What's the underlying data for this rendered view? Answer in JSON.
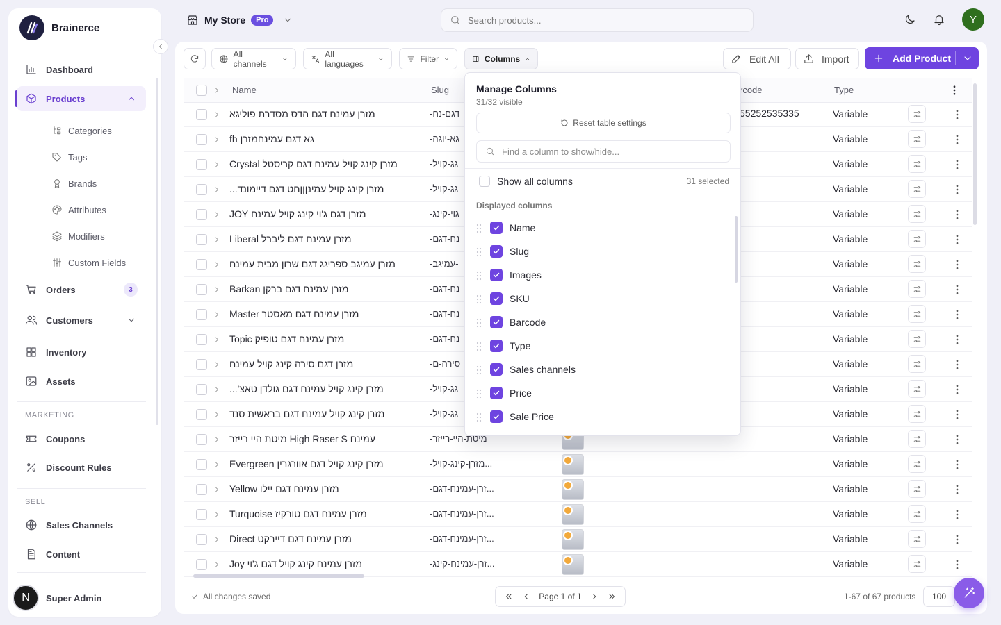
{
  "brand": {
    "name": "Brainerce"
  },
  "sidebar": {
    "items": [
      {
        "label": "Dashboard",
        "icon": "chart-icon"
      },
      {
        "label": "Products",
        "icon": "box-icon"
      },
      {
        "label": "Orders",
        "icon": "cart-icon",
        "badge": "3"
      },
      {
        "label": "Customers",
        "icon": "users-icon"
      },
      {
        "label": "Inventory",
        "icon": "grid-icon"
      },
      {
        "label": "Assets",
        "icon": "image-icon"
      }
    ],
    "sub_items": [
      {
        "label": "Categories"
      },
      {
        "label": "Tags"
      },
      {
        "label": "Brands"
      },
      {
        "label": "Attributes"
      },
      {
        "label": "Modifiers"
      },
      {
        "label": "Custom Fields"
      }
    ],
    "marketing_label": "MARKETING",
    "marketing": [
      {
        "label": "Coupons"
      },
      {
        "label": "Discount Rules"
      }
    ],
    "sell_label": "SELL",
    "sell": [
      {
        "label": "Sales Channels"
      },
      {
        "label": "Content"
      }
    ],
    "user": {
      "initial": "N",
      "name": "Super Admin"
    }
  },
  "topbar": {
    "store_name": "My Store",
    "store_badge": "Pro",
    "search_placeholder": "Search products...",
    "avatar_initial": "Y"
  },
  "toolbar": {
    "channels": "All channels",
    "languages": "All languages",
    "filter": "Filter",
    "columns": "Columns",
    "edit_all": "Edit All",
    "import": "Import",
    "add_product": "Add Product"
  },
  "table": {
    "headers": {
      "name": "Name",
      "slug": "Slug",
      "barcode": "rcode",
      "type": "Type"
    },
    "first_barcode": "55252535335",
    "rows": [
      {
        "name": "מזרן עמינח דגם הדס מסדרת פוליגא",
        "slug": "-דגם-נח",
        "type": "Variable"
      },
      {
        "name": "גא דגם עמינחמזרן fh",
        "slug": "-גא-יוגה",
        "type": "Variable"
      },
      {
        "name": "מזרן קינג קויל עמינח דגם קריסטל Crystal",
        "slug": "-גג-קויל",
        "type": "Variable"
      },
      {
        "name": "מזרן קינג קויל עמינןןןחט דגם דיימונד...",
        "slug": "-גג-קויל",
        "type": "Variable"
      },
      {
        "name": "מזרן דגם ג'וי קינג קויל עמינח JOY",
        "slug": "-גוי-קינג",
        "type": "Variable"
      },
      {
        "name": "מזרן עמינח דגם ליברל Liberal",
        "slug": "-נח-דגם",
        "type": "Variable"
      },
      {
        "name": "מזרן עמיגב ספריגג דגם שרון מבית עמינח",
        "slug": "-עמיגב-",
        "type": "Variable"
      },
      {
        "name": "מזרן עמינח דגם ברקן Barkan",
        "slug": "-נח-דגם",
        "type": "Variable"
      },
      {
        "name": "מזרן עמינח דגם מאסטר Master",
        "slug": "-נח-דגם",
        "type": "Variable"
      },
      {
        "name": "מזרן עמינח דגם טופיק Topic",
        "slug": "-נח-דגם",
        "type": "Variable"
      },
      {
        "name": "מזרן דגם סירה קינג קויל עמינח",
        "slug": "-סירה-ם",
        "type": "Variable"
      },
      {
        "name": "מזרן קינג קויל עמינח דגם גולדן טאצ'...",
        "slug": "-גג-קויל",
        "type": "Variable"
      },
      {
        "name": "מזרן קינג קויל עמינח דגם בראשית סנד",
        "slug": "-גג-קויל",
        "type": "Variable"
      },
      {
        "name": "עמינח High Raser S מיטת היי רייזר",
        "slug": "-מיטת-היי-רייזר",
        "type": "Variable"
      },
      {
        "name": "מזרן קינג קויל דגם אוורגרין Evergreen",
        "slug": "-מזרן-קינג-קויל...",
        "type": "Variable"
      },
      {
        "name": "מזרן עמינח דגם יילו Yellow",
        "slug": "-זרן-עמינח-דגם...",
        "type": "Variable"
      },
      {
        "name": "מזרן עמינח דגם טורקיז Turquoise",
        "slug": "-זרן-עמינח-דגם...",
        "type": "Variable"
      },
      {
        "name": "מזרן עמינח דגם דיירקט Direct",
        "slug": "-זרן-עמינח-דגם...",
        "type": "Variable"
      },
      {
        "name": "מזרן עמינח קינג קויל דגם ג'וי Joy",
        "slug": "-זרן-עמינח-קינג...",
        "type": "Variable"
      }
    ]
  },
  "footer": {
    "saved": "All changes saved",
    "page": "Page 1 of 1",
    "count": "1-67 of 67 products",
    "per_page": "100"
  },
  "columns_menu": {
    "title": "Manage Columns",
    "subtitle": "31/32 visible",
    "reset": "Reset table settings",
    "find_placeholder": "Find a column to show/hide...",
    "show_all": "Show all columns",
    "selected": "31 selected",
    "group": "Displayed columns",
    "items": [
      {
        "label": "Name",
        "checked": true
      },
      {
        "label": "Slug",
        "checked": true
      },
      {
        "label": "Images",
        "checked": true
      },
      {
        "label": "SKU",
        "checked": true
      },
      {
        "label": "Barcode",
        "checked": true
      },
      {
        "label": "Type",
        "checked": true
      },
      {
        "label": "Sales channels",
        "checked": true
      },
      {
        "label": "Price",
        "checked": true
      },
      {
        "label": "Sale Price",
        "checked": true
      }
    ]
  },
  "colors": {
    "accent": "#6e44e0",
    "sidebar_active_bg": "#f3effc",
    "avatar": "#2f6f1e"
  }
}
